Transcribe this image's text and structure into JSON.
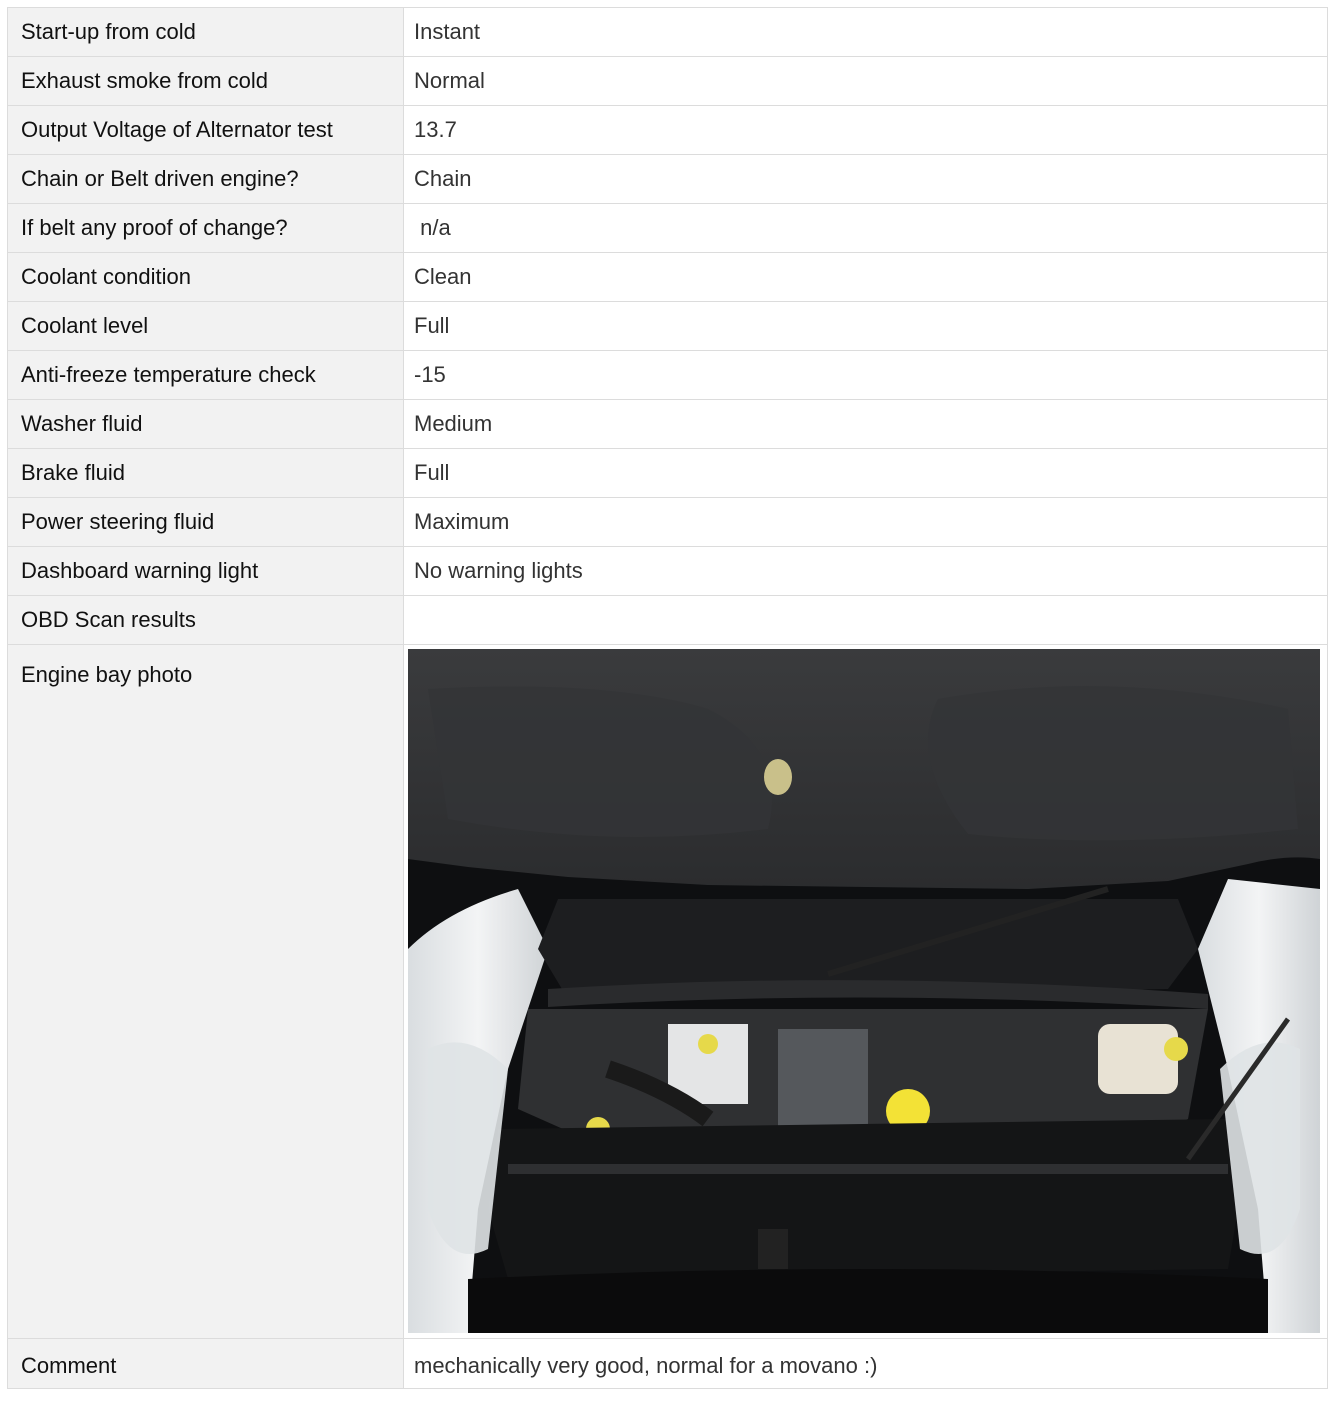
{
  "rows": [
    {
      "label": "Start-up from cold",
      "value": "Instant"
    },
    {
      "label": "Exhaust smoke from cold",
      "value": "Normal"
    },
    {
      "label": "Output Voltage of Alternator test",
      "value": "13.7"
    },
    {
      "label": "Chain or Belt driven engine?",
      "value": "Chain"
    },
    {
      "label": "If belt any proof of change?",
      "value": " n/a"
    },
    {
      "label": "Coolant condition",
      "value": "Clean"
    },
    {
      "label": "Coolant level",
      "value": "Full"
    },
    {
      "label": "Anti-freeze temperature check",
      "value": "-15"
    },
    {
      "label": "Washer fluid",
      "value": "Medium"
    },
    {
      "label": "Brake fluid",
      "value": "Full"
    },
    {
      "label": "Power steering fluid",
      "value": "Maximum"
    },
    {
      "label": "Dashboard warning light",
      "value": "No warning lights"
    },
    {
      "label": "OBD Scan results",
      "value": ""
    }
  ],
  "photo_row": {
    "label": "Engine bay photo",
    "photo_subject": "engine-bay-photo"
  },
  "comment_row": {
    "label": "Comment",
    "value": "mechanically very good, normal for a movano :)"
  }
}
